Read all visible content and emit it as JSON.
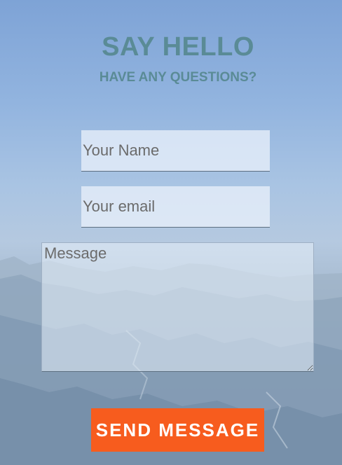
{
  "header": {
    "title": "SAY HELLO",
    "subtitle": "HAVE ANY QUESTIONS?"
  },
  "form": {
    "name_placeholder": "Your Name",
    "email_placeholder": "Your email",
    "message_placeholder": "Message",
    "submit_label": "SEND MESSAGE"
  },
  "colors": {
    "heading": "#5a8b96",
    "button": "#f75c1e",
    "button_text": "#ffffff"
  }
}
